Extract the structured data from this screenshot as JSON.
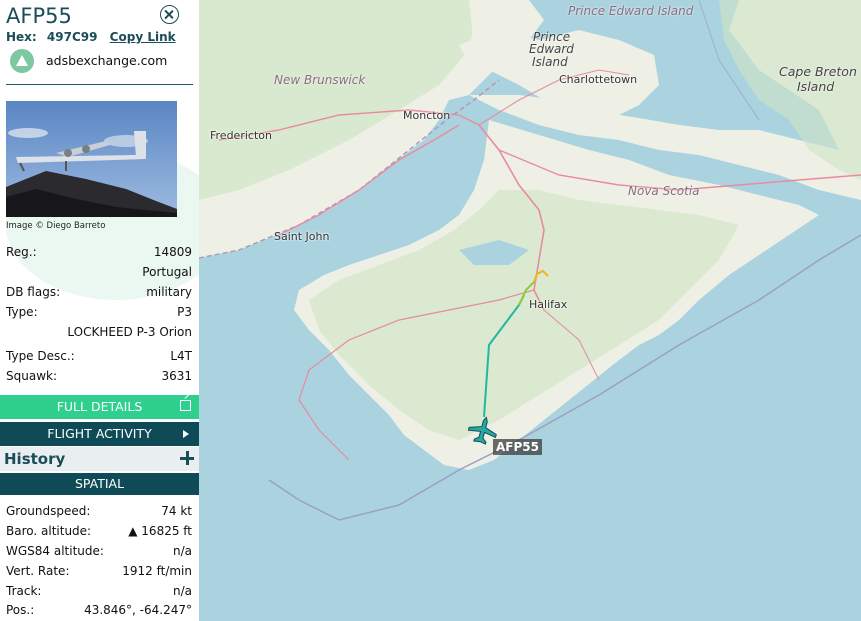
{
  "panel": {
    "callsign": "AFP55",
    "hex_label": "Hex:",
    "hex": "497C99",
    "copy_link": "Copy Link",
    "site": "adsbexchange.com",
    "photo_credit": "Image © Diego Barreto"
  },
  "details": {
    "reg_key": "Reg.:",
    "reg": "14809",
    "country": "Portugal",
    "dbflags_key": "DB flags:",
    "dbflags": "military",
    "type_key": "Type:",
    "type": "P3",
    "type_full": "LOCKHEED P-3 Orion",
    "typedesc_key": "Type Desc.:",
    "typedesc": "L4T",
    "squawk_key": "Squawk:",
    "squawk": "3631"
  },
  "buttons": {
    "full_details": "FULL DETAILS",
    "flight_activity": "FLIGHT ACTIVITY",
    "history": "History",
    "spatial": "SPATIAL"
  },
  "spatial": {
    "gs_key": "Groundspeed:",
    "gs": "74 kt",
    "baro_key": "Baro. altitude:",
    "baro": "▲ 16825 ft",
    "wgs_key": "WGS84 altitude:",
    "wgs": "n/a",
    "vr_key": "Vert. Rate:",
    "vr": "1912 ft/min",
    "track_key": "Track:",
    "track": "n/a",
    "pos_key": "Pos.:",
    "pos": "43.846°, -64.247°"
  },
  "map": {
    "cities": {
      "fredericton": "Fredericton",
      "moncton": "Moncton",
      "charlottetown": "Charlottetown",
      "saint_john": "Saint John",
      "halifax": "Halifax"
    },
    "regions": {
      "new_brunswick": "New Brunswick",
      "pei": "Prince Edward Island",
      "pei_island_1": "Prince",
      "pei_island_2": "Edward",
      "pei_island_3": "Island",
      "nova_scotia": "Nova Scotia",
      "cape_breton_1": "Cape Breton",
      "cape_breton_2": "Island"
    },
    "aircraft_label": "AFP55",
    "colors": {
      "water": "#aad3df",
      "land": "#eef0e6",
      "forest": "#cfe5c4",
      "track_start": "#22b7a0",
      "track_end": "#f2b21b"
    }
  }
}
